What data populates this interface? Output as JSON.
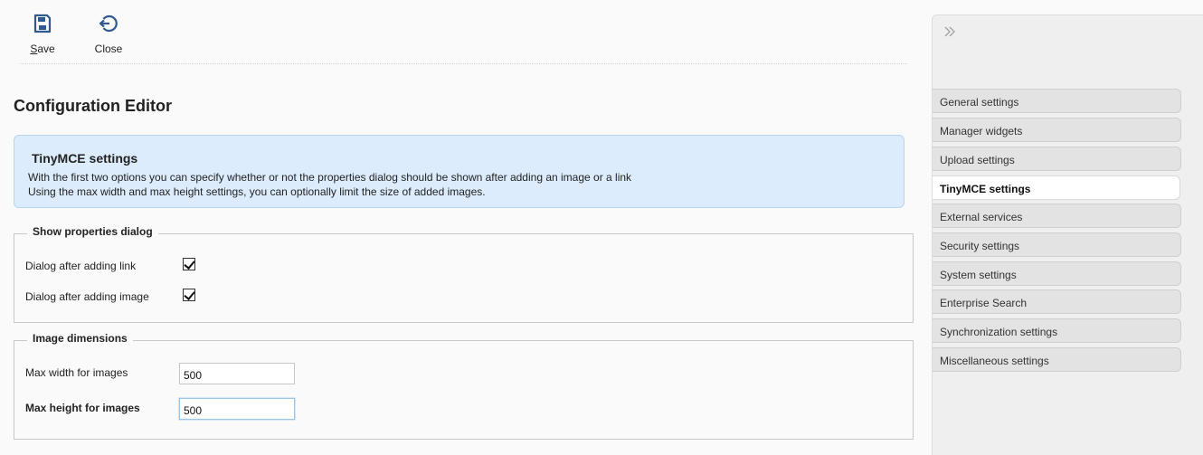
{
  "toolbar": {
    "save_label_first": "S",
    "save_label_rest": "ave",
    "close_label": "Close"
  },
  "page": {
    "title": "Configuration Editor"
  },
  "info": {
    "title": "TinyMCE settings",
    "line1": "With the first two options you can specify whether or not the properties dialog should be shown after adding an image or a link",
    "line2": "Using the max width and max height settings, you can optionally limit the size of added images."
  },
  "properties_dialog": {
    "legend": "Show properties dialog",
    "link_label": "Dialog after adding link",
    "link_checked": true,
    "image_label": "Dialog after adding image",
    "image_checked": true
  },
  "image_dimensions": {
    "legend": "Image dimensions",
    "max_width_label": "Max width for images",
    "max_width_value": "500",
    "max_height_label": "Max height for images",
    "max_height_value": "500"
  },
  "sidebar": {
    "collapse_icon": "double-chevron-right-icon",
    "items": [
      {
        "label": "General settings",
        "active": false
      },
      {
        "label": "Manager widgets",
        "active": false
      },
      {
        "label": "Upload settings",
        "active": false
      },
      {
        "label": "TinyMCE settings",
        "active": true
      },
      {
        "label": "External services",
        "active": false
      },
      {
        "label": "Security settings",
        "active": false
      },
      {
        "label": "System settings",
        "active": false
      },
      {
        "label": "Enterprise Search",
        "active": false
      },
      {
        "label": "Synchronization settings",
        "active": false
      },
      {
        "label": "Miscellaneous settings",
        "active": false
      }
    ]
  },
  "colors": {
    "accent": "#2f5a8f",
    "info_background": "#dcecfc"
  }
}
